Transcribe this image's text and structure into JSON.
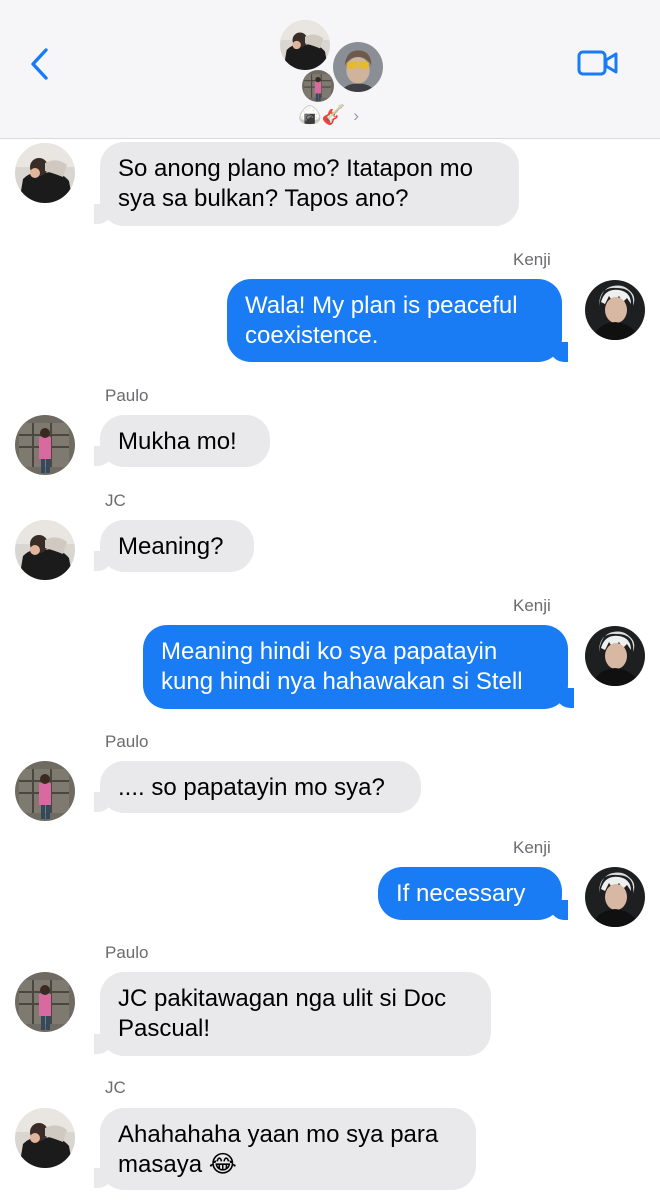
{
  "header": {
    "group_title": "🍙🎸",
    "chevron": "›",
    "back_icon": "chevron-left-icon",
    "video_icon": "video-camera-icon"
  },
  "colors": {
    "accent": "#1a7cf5",
    "incoming_bubble": "#e9e9eb",
    "header_bg": "#f6f6f8"
  },
  "messages": [
    {
      "direction": "in",
      "sender": "",
      "lines": [
        "So anong plano mo? Itatapon mo",
        "sya sa bulkan? Tapos ano?"
      ]
    },
    {
      "direction": "out",
      "sender": "Kenji",
      "lines": [
        "Wala! My plan is peaceful",
        "coexistence."
      ]
    },
    {
      "direction": "in",
      "sender": "Paulo",
      "lines": [
        "Mukha mo!"
      ]
    },
    {
      "direction": "in",
      "sender": "JC",
      "lines": [
        "Meaning?"
      ]
    },
    {
      "direction": "out",
      "sender": "Kenji",
      "lines": [
        "Meaning hindi ko sya papatayin",
        "kung hindi nya hahawakan si Stell"
      ]
    },
    {
      "direction": "in",
      "sender": "Paulo",
      "lines": [
        ".... so papatayin mo sya?"
      ]
    },
    {
      "direction": "out",
      "sender": "Kenji",
      "lines": [
        "If necessary"
      ]
    },
    {
      "direction": "in",
      "sender": "Paulo",
      "lines": [
        "JC pakitawagan nga ulit si Doc",
        "Pascual!"
      ]
    },
    {
      "direction": "in",
      "sender": "JC",
      "lines": [
        "Ahahahaha yaan mo sya para",
        "masaya 😂"
      ]
    }
  ]
}
